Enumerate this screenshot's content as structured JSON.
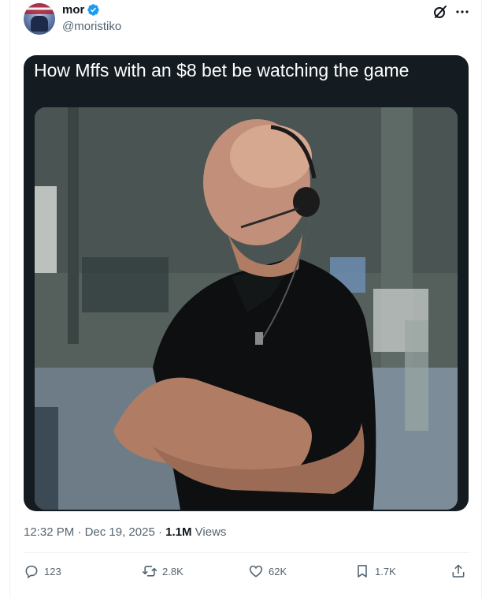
{
  "tweet": {
    "author": {
      "display_name": "mor",
      "handle": "@moristiko",
      "verified": true
    },
    "media": {
      "caption": "How Mffs with an $8 bet be watching the game"
    },
    "meta": {
      "time": "12:32 PM",
      "separator": "·",
      "date": "Dec 19, 2025",
      "views_count": "1.1M",
      "views_label": "Views"
    },
    "actions": {
      "reply_count": "123",
      "retweet_count": "2.8K",
      "like_count": "62K",
      "bookmark_count": "1.7K"
    }
  },
  "colors": {
    "text_primary": "#0f1419",
    "text_secondary": "#536471",
    "verified_blue": "#1d9bf0",
    "media_background": "#141c22",
    "divider": "#eff3f4"
  },
  "icons": [
    "verified-badge-icon",
    "grok-icon",
    "more-icon",
    "reply-icon",
    "retweet-icon",
    "like-icon",
    "bookmark-icon",
    "share-icon"
  ]
}
